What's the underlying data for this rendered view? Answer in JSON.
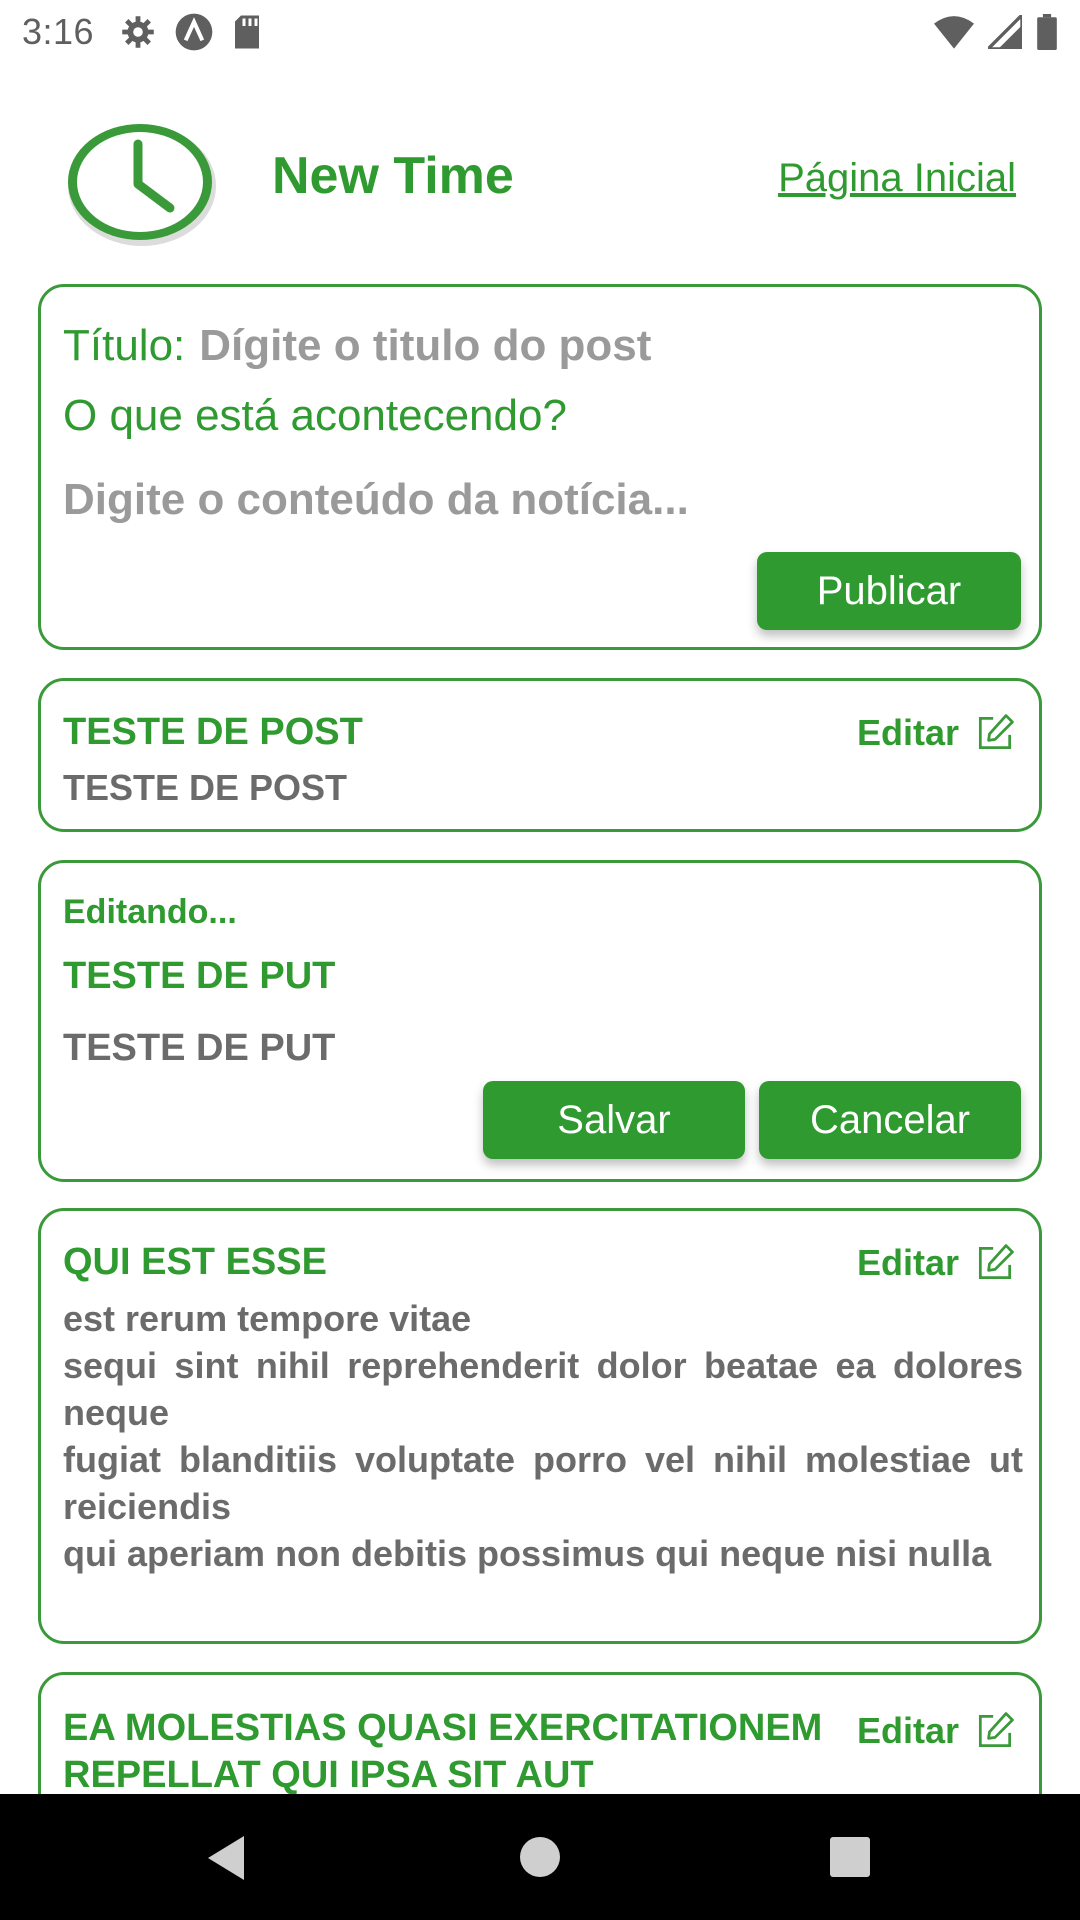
{
  "status_bar": {
    "time": "3:16",
    "icons": [
      "settings-icon",
      "a-icon",
      "sd-card-icon",
      "wifi-icon",
      "signal-icon",
      "battery-icon"
    ]
  },
  "header": {
    "app_title": "New Time",
    "home_link": "Página Inicial",
    "accent_color": "#2f9a2f"
  },
  "composer": {
    "title_label": "Título:",
    "title_placeholder": "Dígite o titulo do post",
    "prompt": "O que está acontecendo?",
    "content_placeholder": "Digite o conteúdo da notícia...",
    "publish_label": "Publicar"
  },
  "posts": [
    {
      "title": "TESTE DE POST",
      "body": "TESTE DE POST",
      "edit_label": "Editar"
    },
    {
      "editing_label": "Editando...",
      "title": "TESTE DE PUT",
      "body": "TESTE DE PUT",
      "save_label": "Salvar",
      "cancel_label": "Cancelar"
    },
    {
      "title": "QUI EST ESSE",
      "body_lines": [
        "est rerum tempore vitae",
        "sequi sint nihil reprehenderit dolor beatae ea dolores neque",
        "fugiat blanditiis voluptate porro vel nihil molestiae ut reiciendis",
        "qui aperiam non debitis possimus qui neque nisi nulla"
      ],
      "edit_label": "Editar"
    },
    {
      "title": "EA MOLESTIAS QUASI EXERCITATIONEM REPELLAT QUI IPSA SIT AUT",
      "edit_label": "Editar"
    }
  ],
  "nav_bar": {
    "icons": [
      "back-icon",
      "home-icon",
      "recents-icon"
    ]
  }
}
